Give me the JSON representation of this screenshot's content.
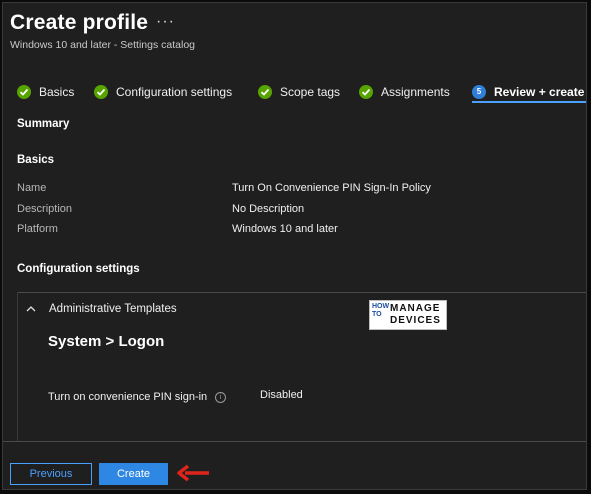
{
  "header": {
    "title": "Create profile",
    "more_icon": "ellipsis-icon",
    "subtitle": "Windows 10 and later - Settings catalog"
  },
  "wizard": {
    "steps": [
      {
        "label": "Basics",
        "state": "complete"
      },
      {
        "label": "Configuration settings",
        "state": "complete"
      },
      {
        "label": "Scope tags",
        "state": "complete"
      },
      {
        "label": "Assignments",
        "state": "complete"
      },
      {
        "label": "Review + create",
        "state": "current",
        "number": "5"
      }
    ]
  },
  "summary": {
    "title": "Summary",
    "basics": {
      "title": "Basics",
      "rows": [
        {
          "label": "Name",
          "value": "Turn On Convenience PIN Sign-In Policy"
        },
        {
          "label": "Description",
          "value": "No Description"
        },
        {
          "label": "Platform",
          "value": "Windows 10 and later"
        }
      ]
    },
    "configuration": {
      "title": "Configuration settings",
      "group": "Administrative Templates",
      "path": "System > Logon",
      "setting": {
        "label": "Turn on convenience PIN sign-in",
        "value": "Disabled",
        "info": "i"
      }
    }
  },
  "watermark": {
    "line1": "HOW",
    "line2": "TO",
    "line3": "MANAGE",
    "line4": "DEVICES"
  },
  "footer": {
    "previous_label": "Previous",
    "create_label": "Create"
  },
  "colors": {
    "accent": "#2f87e4",
    "check": "#57a300",
    "annotation": "#e0241b"
  }
}
